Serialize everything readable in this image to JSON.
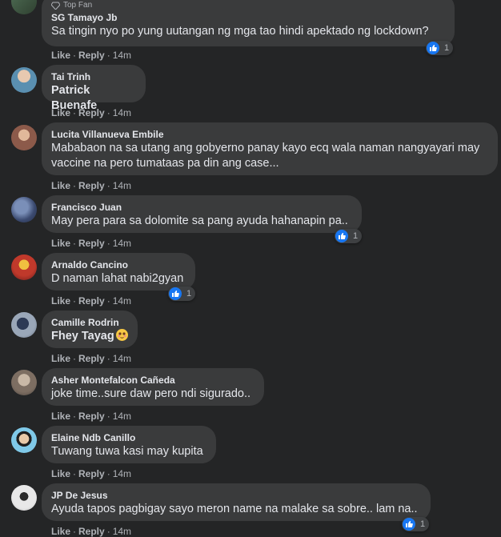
{
  "badge_label": "Top Fan",
  "comments": [
    {
      "author": "SG Tamayo Jb",
      "text": "Sa tingin nyo po yung uutangan ng mga tao hindi apektado ng lockdown?",
      "like": "Like",
      "reply": "Reply",
      "time": "14m",
      "reactions": "1"
    },
    {
      "author": "Tai Trinh",
      "text": "Patrick Buenafe",
      "like": "Like",
      "reply": "Reply",
      "time": "14m"
    },
    {
      "author": "Lucita Villanueva Embile",
      "text_lines": [
        "Mababaon na sa utang ang gobyerno panay kayo ecq wala naman nangyayari may",
        "vaccine na pero tumataas pa din ang case..."
      ],
      "like": "Like",
      "reply": "Reply",
      "time": "14m"
    },
    {
      "author": "Francisco Juan",
      "text": "May pera para sa dolomite sa pang ayuda hahanapin pa..",
      "like": "Like",
      "reply": "Reply",
      "time": "14m",
      "reactions": "1"
    },
    {
      "author": "Arnaldo Cancino",
      "text": "D naman lahat nabi2gyan",
      "like": "Like",
      "reply": "Reply",
      "time": "14m",
      "reactions": "1"
    },
    {
      "author": "Camille Rodrin",
      "text": "Fhey Tayag",
      "like": "Like",
      "reply": "Reply",
      "time": "14m"
    },
    {
      "author": "Asher Montefalcon Cañeda",
      "text": "joke time..sure daw pero ndi sigurado..",
      "like": "Like",
      "reply": "Reply",
      "time": "14m"
    },
    {
      "author": "Elaine Ndb Canillo",
      "text": "Tuwang tuwa kasi may kupita",
      "like": "Like",
      "reply": "Reply",
      "time": "14m"
    },
    {
      "author": "JP De Jesus",
      "text": "Ayuda tapos pagbigay sayo meron name na malake sa sobre.. lam na..",
      "like": "Like",
      "reply": "Reply",
      "time": "14m",
      "reactions": "1"
    }
  ]
}
